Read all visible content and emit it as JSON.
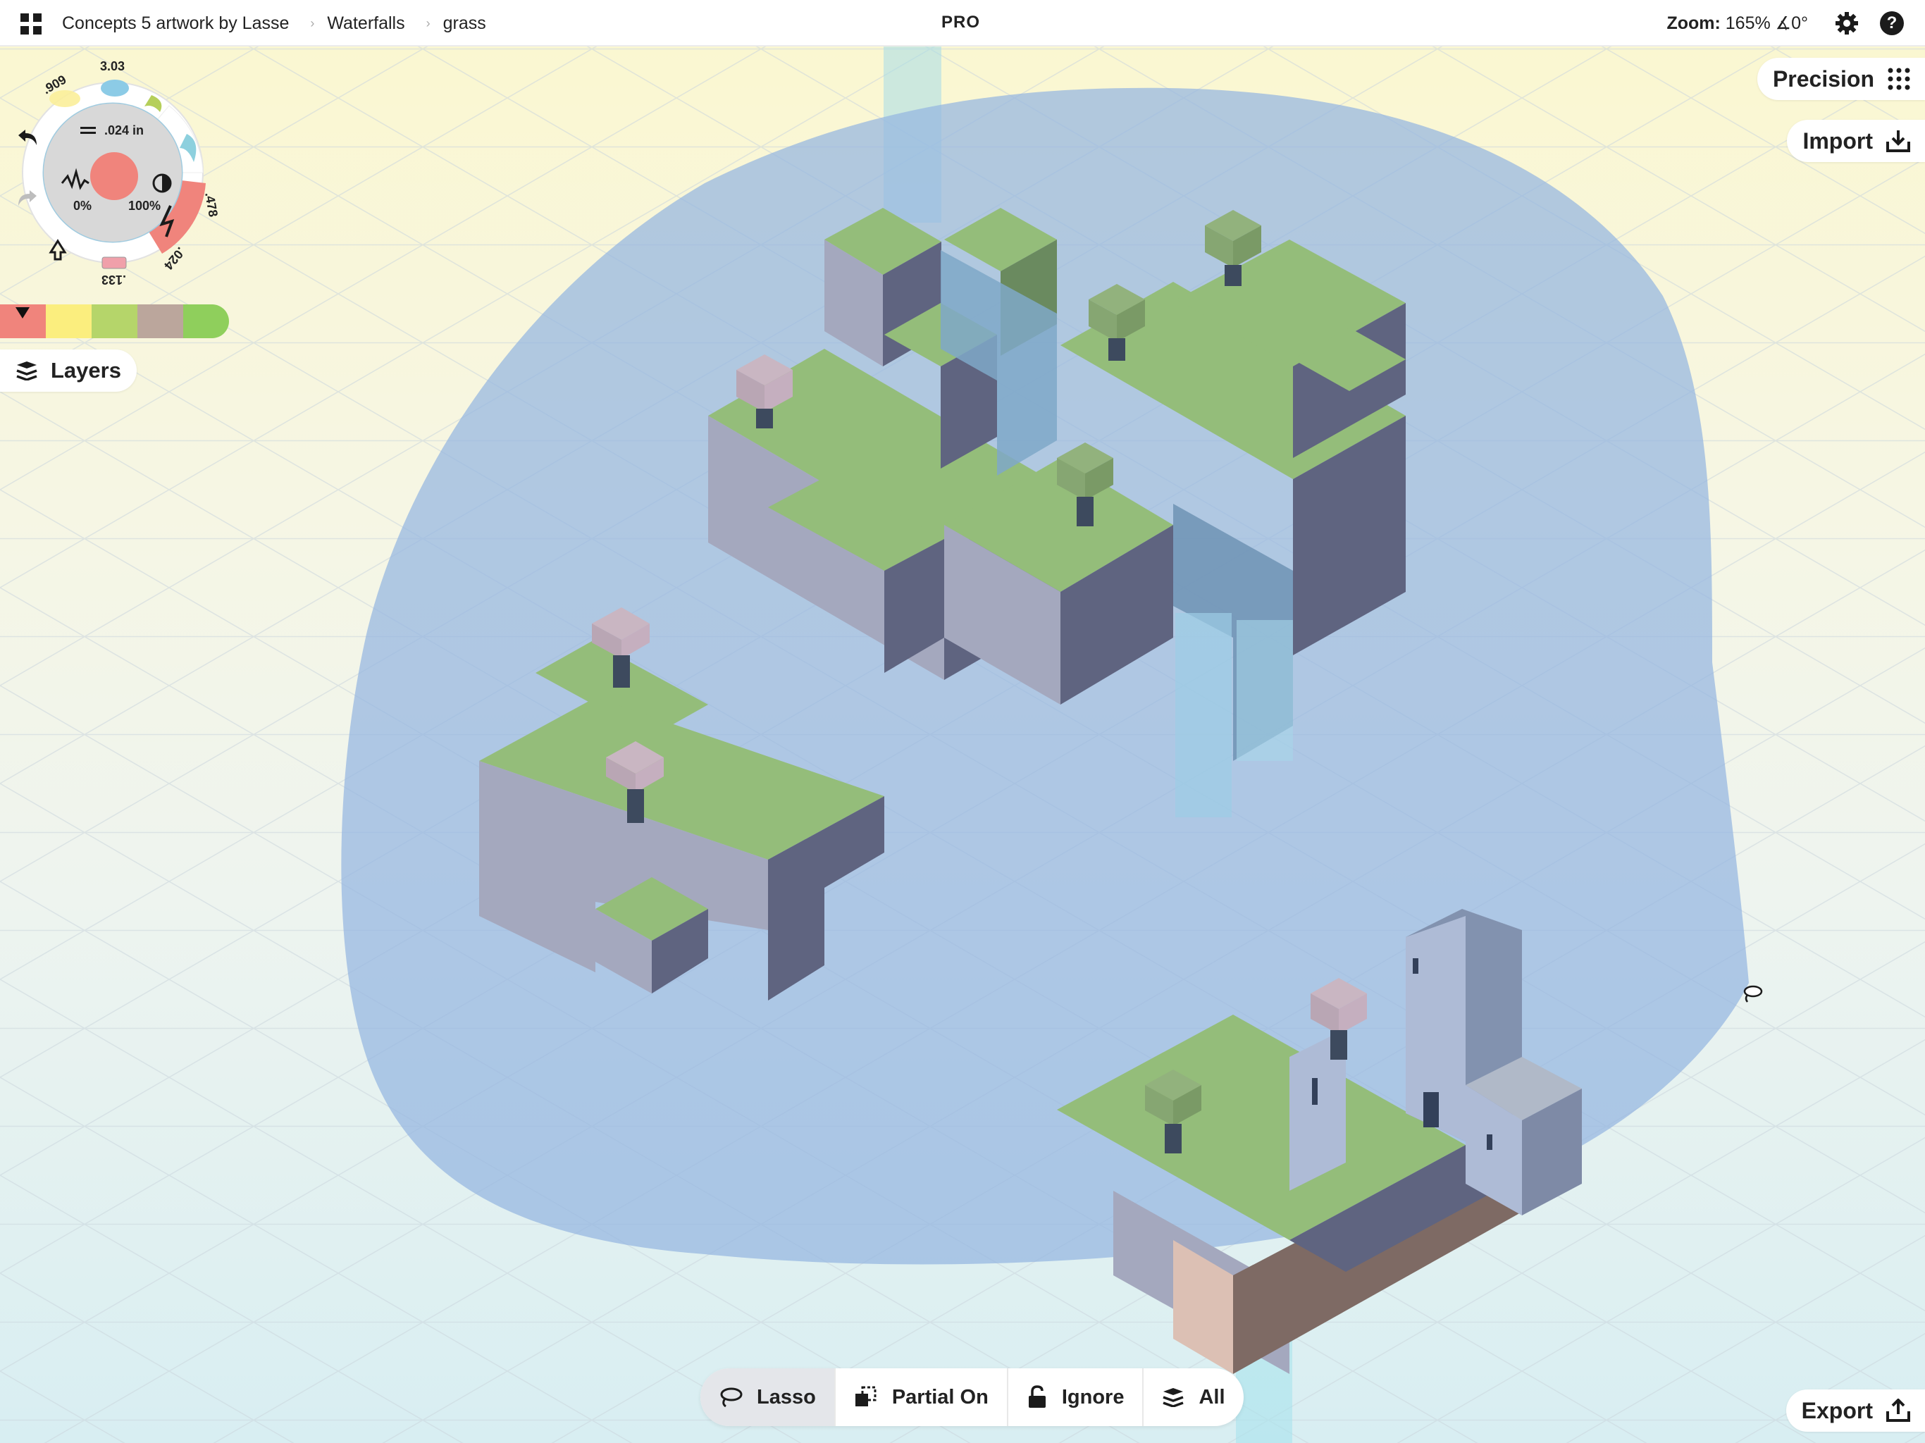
{
  "topbar": {
    "breadcrumbs": [
      "Concepts 5 artwork by Lasse",
      "Waterfalls",
      "grass"
    ],
    "pro_label": "PRO",
    "zoom_label": "Zoom:",
    "zoom_value": "165%",
    "rotation_value": "∡0°"
  },
  "tool_wheel": {
    "size_label": ".024 in",
    "opacity_min": "0%",
    "opacity_max": "100%",
    "slot_values": [
      ".909",
      "3.03",
      ".478",
      ".024",
      ".133"
    ],
    "active_color": "#f0847c"
  },
  "palette": {
    "colors": [
      "#f0847c",
      "#fbee7e",
      "#b5d56a",
      "#bba69c",
      "#8fcf5c"
    ],
    "selected_index": 0
  },
  "layers_button": {
    "label": "Layers"
  },
  "precision_button": {
    "label": "Precision"
  },
  "import_button": {
    "label": "Import"
  },
  "export_button": {
    "label": "Export"
  },
  "selection_toolbar": {
    "lasso": "Lasso",
    "partial": "Partial On",
    "ignore": "Ignore",
    "all": "All"
  },
  "icons": {
    "menu": "grid-icon",
    "settings": "gear-icon",
    "help": "help-icon",
    "undo": "undo-icon",
    "redo": "redo-icon",
    "layers": "layers-icon",
    "precision": "dot-grid-icon",
    "import": "import-icon",
    "export": "export-icon",
    "lasso": "lasso-icon",
    "partial": "partial-select-icon",
    "ignore": "unlock-icon",
    "all": "layers-icon"
  }
}
